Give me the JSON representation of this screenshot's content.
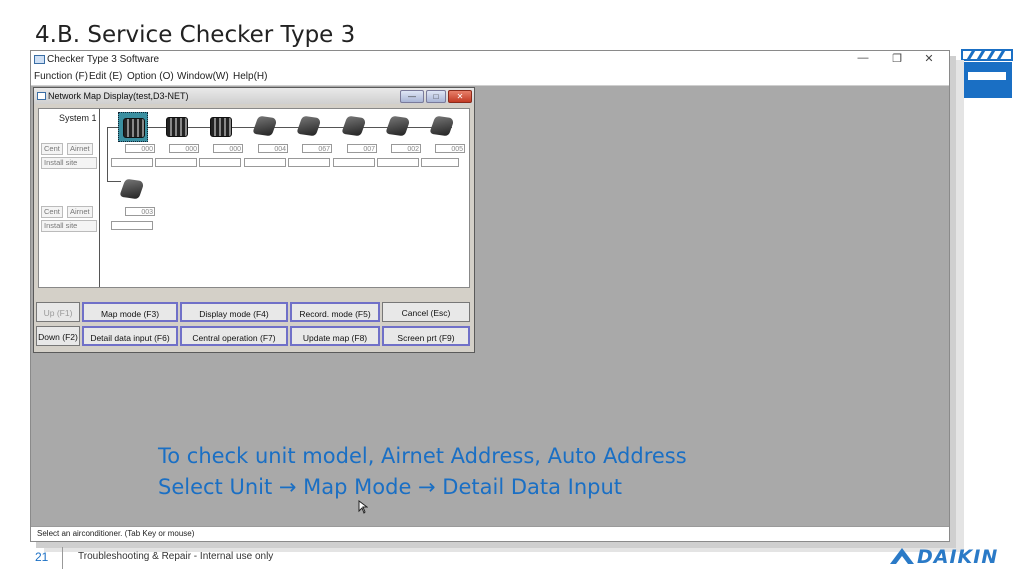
{
  "slide": {
    "title": "4.B. Service Checker Type 3",
    "caption_line1": "To check unit model, Airnet Address, Auto Address",
    "caption_line2": "Select Unit → Map Mode → Detail Data Input",
    "page_number": "21",
    "footer": "Troubleshooting & Repair - Internal use only",
    "logo": "DAIKIN"
  },
  "app": {
    "title": "Checker Type 3 Software",
    "controls": [
      "—",
      "❐",
      "✕"
    ],
    "menu": [
      "Function (F)",
      "Edit (E)",
      "Option (O)",
      "Window(W)",
      "Help(H)"
    ],
    "status": "Select an airconditioner. (Tab Key or mouse)"
  },
  "child": {
    "title": "Network Map Display(test,D3-NET)",
    "controls": [
      "—",
      "□",
      "✕"
    ],
    "system_label": "System 1",
    "row_labels": {
      "cent": "Cent",
      "airnet": "Airnet",
      "install": "Install site"
    },
    "row1_addresses": [
      "000",
      "000",
      "000",
      "004",
      "067",
      "007",
      "002",
      "005"
    ],
    "row2_addresses": [
      "003"
    ],
    "buttons": {
      "up": "Up (F1)",
      "down": "Down (F2)",
      "map_mode": "Map mode (F3)",
      "display_mode": "Display mode (F4)",
      "record_mode": "Record. mode (F5)",
      "cancel": "Cancel (Esc)",
      "detail": "Detail data input (F6)",
      "central": "Central operation (F7)",
      "update": "Update map (F8)",
      "screen": "Screen prt (F9)"
    }
  }
}
